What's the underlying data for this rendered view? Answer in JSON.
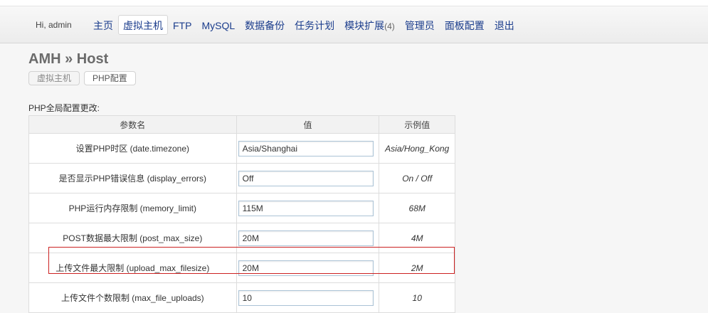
{
  "header": {
    "greeting": "Hi, admin",
    "nav": [
      {
        "label": "主页"
      },
      {
        "label": "虚拟主机",
        "active": true
      },
      {
        "label": "FTP"
      },
      {
        "label": "MySQL"
      },
      {
        "label": "数据备份"
      },
      {
        "label": "任务计划"
      },
      {
        "label": "模块扩展",
        "count": "(4)"
      },
      {
        "label": "管理员"
      },
      {
        "label": "面板配置"
      },
      {
        "label": "退出"
      }
    ]
  },
  "page": {
    "title": "AMH » Host",
    "subtabs": [
      {
        "label": "虚拟主机"
      },
      {
        "label": "PHP配置",
        "active": true
      }
    ],
    "section_label": "PHP全局配置更改:"
  },
  "table": {
    "headers": {
      "name": "参数名",
      "value": "值",
      "example": "示例值"
    },
    "rows": [
      {
        "name": "设置PHP时区 (date.timezone)",
        "value": "Asia/Shanghai",
        "example": "Asia/Hong_Kong"
      },
      {
        "name": "是否显示PHP错误信息 (display_errors)",
        "value": "Off",
        "example": "On / Off"
      },
      {
        "name": "PHP运行内存限制 (memory_limit)",
        "value": "115M",
        "example": "68M"
      },
      {
        "name": "POST数据最大限制 (post_max_size)",
        "value": "20M",
        "example": "4M"
      },
      {
        "name": "上传文件最大限制 (upload_max_filesize)",
        "value": "20M",
        "example": "2M",
        "highlighted": true
      },
      {
        "name": "上传文件个数限制 (max_file_uploads)",
        "value": "10",
        "example": "10"
      }
    ]
  },
  "colors": {
    "nav_text": "#1a3c8c",
    "highlight_border": "#cc2222"
  }
}
